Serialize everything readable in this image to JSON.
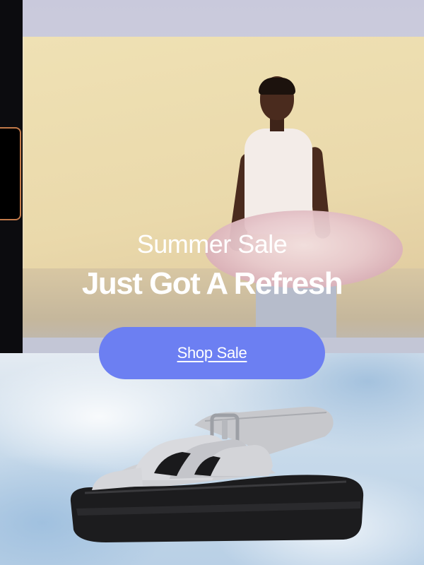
{
  "hero": {
    "headline_sub": "Summer Sale",
    "headline_main": "Just Got A Refresh"
  },
  "cta": {
    "label": "Shop Sale",
    "color": "#6c7ff2"
  },
  "product": {
    "icon": "sandal-image"
  }
}
